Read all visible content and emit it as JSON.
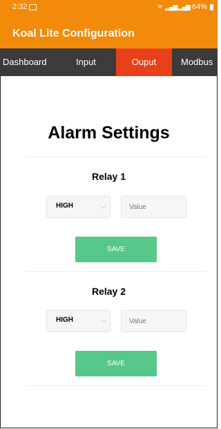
{
  "status_bar": {
    "time": "2:32",
    "signal_text": "⁴⁶ᴺᵢₗ.ₗ ⁴⁶ᴺᵢₗ.ₗ",
    "battery": "64%"
  },
  "app": {
    "title": "Koal Lite Configuration",
    "accent_color": "#f28a0c"
  },
  "tabs": [
    {
      "label": "Dashboard"
    },
    {
      "label": "Input"
    },
    {
      "label": "Ouput",
      "active": true,
      "color": "#e8401a"
    },
    {
      "label": "Modbus"
    }
  ],
  "main": {
    "heading": "Alarm Settings",
    "relays": [
      {
        "title": "Relay 1",
        "select_value": "HIGH",
        "value_placeholder": "Value",
        "save_label": "SAVE"
      },
      {
        "title": "Relay 2",
        "select_value": "HIGH",
        "value_placeholder": "Value",
        "save_label": "SAVE"
      }
    ],
    "save_color": "#57c78a"
  }
}
